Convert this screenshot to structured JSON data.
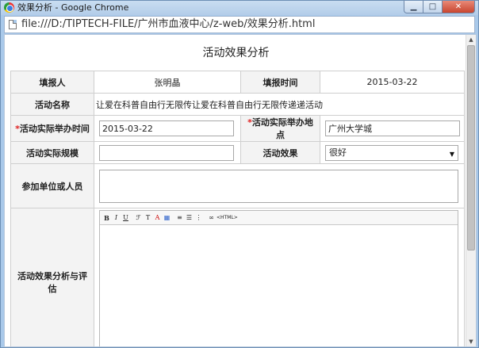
{
  "window": {
    "title": "效果分析 - Google Chrome",
    "buttons": {
      "minimize": "▁",
      "maximize": "□",
      "close": "✕"
    }
  },
  "address": {
    "url": "file:///D:/TIPTECH-FILE/广州市血液中心/z-web/效果分析.html"
  },
  "page": {
    "title": "活动效果分析"
  },
  "form": {
    "reporter_label": "填报人",
    "reporter_value": "张明晶",
    "report_time_label": "填报时间",
    "report_time_value": "2015-03-22",
    "activity_name_label": "活动名称",
    "activity_name_value": "让爱在科普自由行无限传让爱在科普自由行无限传递递活动",
    "required_mark": "*",
    "actual_time_label": "活动实际举办时间",
    "actual_time_value": "2015-03-22",
    "actual_place_label": "活动实际举办地点",
    "actual_place_value": "广州大学城",
    "scale_label": "活动实际规模",
    "scale_value": "",
    "effect_label": "活动效果",
    "effect_selected": "很好",
    "participants_label": "参加单位或人员",
    "analysis_label": "活动效果分析与评估"
  },
  "editor": {
    "toolbar": {
      "bold": "B",
      "italic": "I",
      "underline": "U",
      "font": "ℱ",
      "size": "T",
      "color": "A",
      "bg": "▦",
      "align": "≡",
      "ul": "☰",
      "ol": "⋮",
      "link": "∞",
      "html": "<HTML>"
    }
  },
  "scrollbar": {
    "up": "▲",
    "down": "▼"
  },
  "colors": {
    "required": "#e02020",
    "label_bg": "#f3f3f3",
    "border": "#cfcfcf"
  }
}
